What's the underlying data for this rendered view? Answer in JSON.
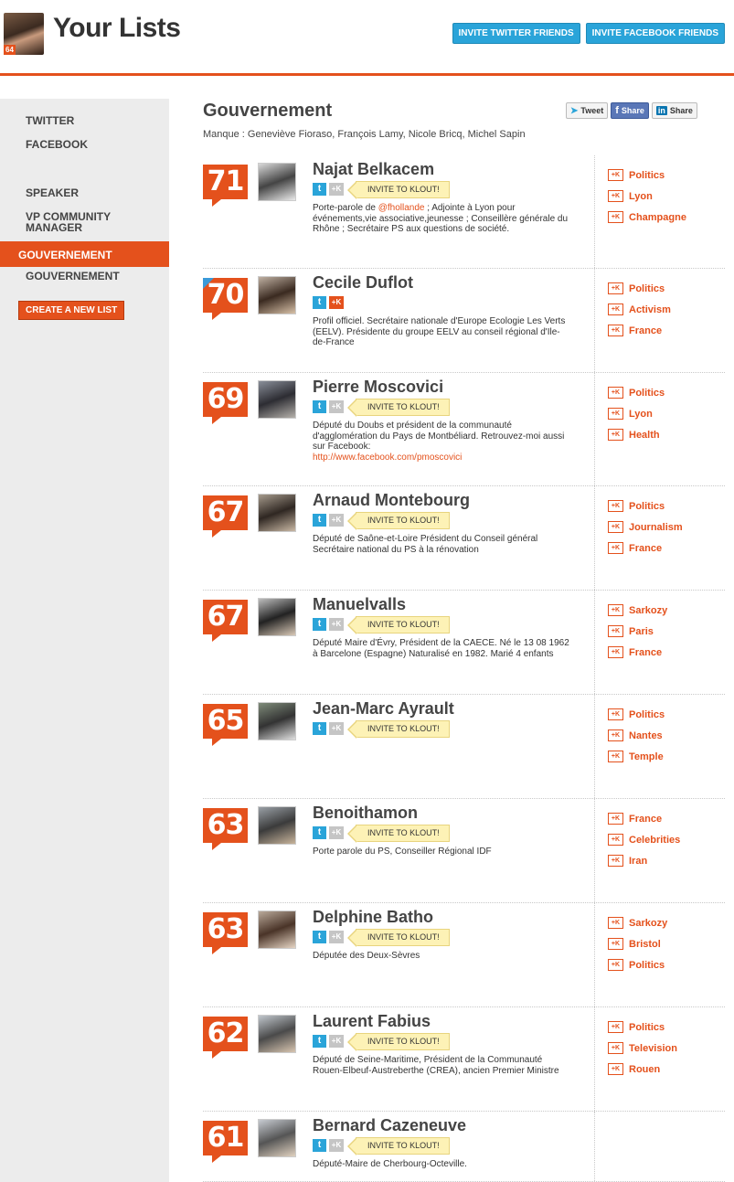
{
  "header": {
    "title": "Your Lists",
    "user_score": "64",
    "invite_twitter": "INVITE TWITTER FRIENDS",
    "invite_facebook": "INVITE FACEBOOK FRIENDS"
  },
  "sidebar": {
    "items": [
      "TWITTER",
      "FACEBOOK",
      "SPEAKER",
      "VP COMMUNITY",
      "MANAGER",
      "GOUVERNEMENT",
      "GOUVERNEMENT"
    ],
    "create_button": "CREATE A NEW LIST"
  },
  "list": {
    "title": "Gouvernement",
    "missing": "Manque : Geneviève Fioraso, François Lamy, Nicole Bricq, Michel Sapin",
    "share": {
      "tweet": "Tweet",
      "facebook": "Share",
      "linkedin_in": "in",
      "linkedin": "Share"
    }
  },
  "invite_label": "INVITE TO KLOUT!",
  "entries": [
    {
      "score": "71",
      "name": "Najat Belkacem",
      "bio_pre": "Porte-parole de ",
      "bio_mention": "@fhollande",
      "bio_post": " ; Adjointe à Lyon pour événements,vie associative,jeunesse ; Conseillère générale du Rhône ; Secrétaire PS aux questions de société.",
      "topics": [
        "Politics",
        "Lyon",
        "Champagne"
      ]
    },
    {
      "score": "70",
      "name": "Cecile Duflot",
      "bio_pre": "Profil officiel. Secrétaire nationale d'Europe Ecologie Les Verts (EELV). Présidente du groupe EELV au conseil régional d'Ile-de-France",
      "bio_mention": "",
      "bio_post": "",
      "topics": [
        "Politics",
        "Activism",
        "France"
      ]
    },
    {
      "score": "69",
      "name": "Pierre Moscovici",
      "bio_pre": "Député du Doubs et président de la communauté d'agglomération du Pays de Montbéliard. Retrouvez-moi aussi sur Facebook:",
      "bio_link": "http://www.facebook.com/pmoscovici",
      "topics": [
        "Politics",
        "Lyon",
        "Health"
      ]
    },
    {
      "score": "67",
      "name": "Arnaud Montebourg",
      "bio_pre": "Député de Saône-et-Loire Président du Conseil général Secrétaire national du PS à la rénovation",
      "topics": [
        "Politics",
        "Journalism",
        "France"
      ]
    },
    {
      "score": "67",
      "name": "Manuelvalls",
      "bio_pre": "Député Maire d'Évry, Président de la CAECE. Né le 13 08 1962 à Barcelone (Espagne) Naturalisé en 1982. Marié 4 enfants",
      "topics": [
        "Sarkozy",
        "Paris",
        "France"
      ]
    },
    {
      "score": "65",
      "name": "Jean-Marc Ayrault",
      "bio_pre": "",
      "topics": [
        "Politics",
        "Nantes",
        "Temple"
      ]
    },
    {
      "score": "63",
      "name": "Benoithamon",
      "bio_pre": "Porte parole du PS, Conseiller Régional IDF",
      "topics": [
        "France",
        "Celebrities",
        "Iran"
      ]
    },
    {
      "score": "63",
      "name": "Delphine Batho",
      "bio_pre": "Députée des Deux-Sèvres",
      "topics": [
        "Sarkozy",
        "Bristol",
        "Politics"
      ]
    },
    {
      "score": "62",
      "name": "Laurent Fabius",
      "bio_pre": "Député de Seine-Maritime, Président de la Communauté Rouen-Elbeuf-Austreberthe (CREA), ancien Premier Ministre",
      "topics": [
        "Politics",
        "Television",
        "Rouen"
      ]
    },
    {
      "score": "61",
      "name": "Bernard Cazeneuve",
      "bio_pre": "Député-Maire de Cherbourg-Octeville.",
      "topics": []
    }
  ],
  "colors": {
    "accent": "#e4511c",
    "twitter": "#2aa4d9",
    "invite_bg": "#fdf2b6"
  },
  "icons": {
    "topic": "klout-k-icon",
    "twitter": "twitter-icon",
    "klout": "klout-icon"
  }
}
